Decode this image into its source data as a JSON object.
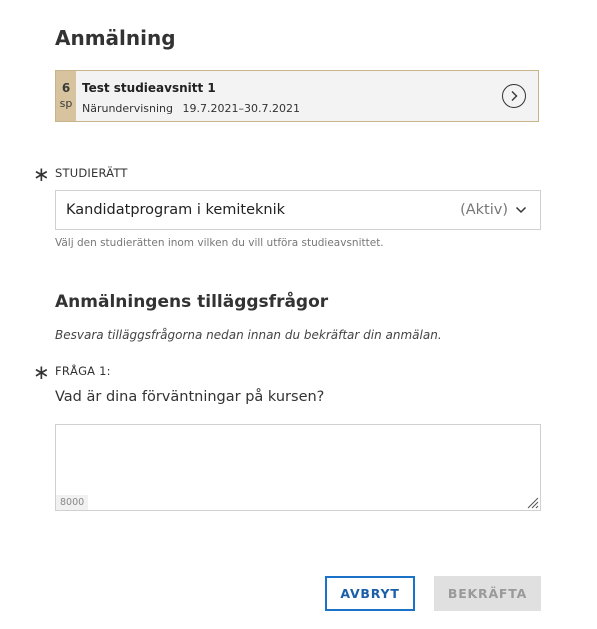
{
  "dialog": {
    "title": "Anmälning"
  },
  "course": {
    "credits": "6",
    "credits_unit": "sp",
    "name": "Test studieavsnitt 1",
    "type": "Närundervisning",
    "dates": "19.7.2021–30.7.2021",
    "open_icon": "chevron-right-circle-icon"
  },
  "study_right": {
    "required_mark": "∗",
    "label": "STUDIERÄTT",
    "selected": "Kandidatprogram i kemiteknik",
    "status": "(Aktiv)",
    "hint": "Välj den studierätten inom vilken du vill utföra studieavsnittet."
  },
  "questions_section": {
    "title": "Anmälningens tilläggsfrågor",
    "instructions": "Besvara tilläggsfrågorna nedan innan du bekräftar din anmälan.",
    "question1": {
      "required_mark": "∗",
      "label": "FRÅGA 1:",
      "text": "Vad är dina förväntningar på kursen?",
      "answer": "",
      "char_limit": "8000"
    }
  },
  "actions": {
    "cancel": "AVBRYT",
    "confirm": "BEKRÄFTA"
  },
  "colors": {
    "accent": "#1a73c9",
    "credit_bg": "#d7c49e",
    "card_border": "#c8b48a"
  }
}
